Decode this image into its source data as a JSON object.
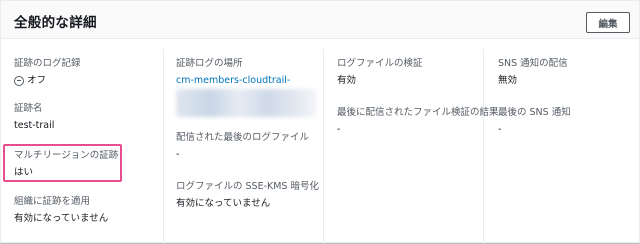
{
  "header": {
    "title": "全般的な詳細",
    "edit_label": "編集"
  },
  "col1": {
    "log_record": {
      "label": "証跡のログ記録",
      "value": "オフ"
    },
    "trail_name": {
      "label": "証跡名",
      "value": "test-trail"
    },
    "multi_region": {
      "label": "マルチリージョンの証跡",
      "value": "はい"
    },
    "org_apply": {
      "label": "組織に証跡を適用",
      "value": "有効になっていません"
    }
  },
  "col2": {
    "log_location": {
      "label": "証跡ログの場所",
      "value": "cm-members-cloudtrail-"
    },
    "last_log_file": {
      "label": "配信された最後のログファイル",
      "value": "-"
    },
    "sse_kms": {
      "label": "ログファイルの SSE-KMS 暗号化",
      "value": "有効になっていません"
    }
  },
  "col3": {
    "log_validation": {
      "label": "ログファイルの検証",
      "value": "有効"
    },
    "last_validation": {
      "label": "最後に配信されたファイル検証の結果",
      "value": "-"
    }
  },
  "col4": {
    "sns_delivery": {
      "label": "SNS 通知の配信",
      "value": "無効"
    },
    "last_sns": {
      "label": "最後の SNS 通知",
      "value": "-"
    }
  }
}
